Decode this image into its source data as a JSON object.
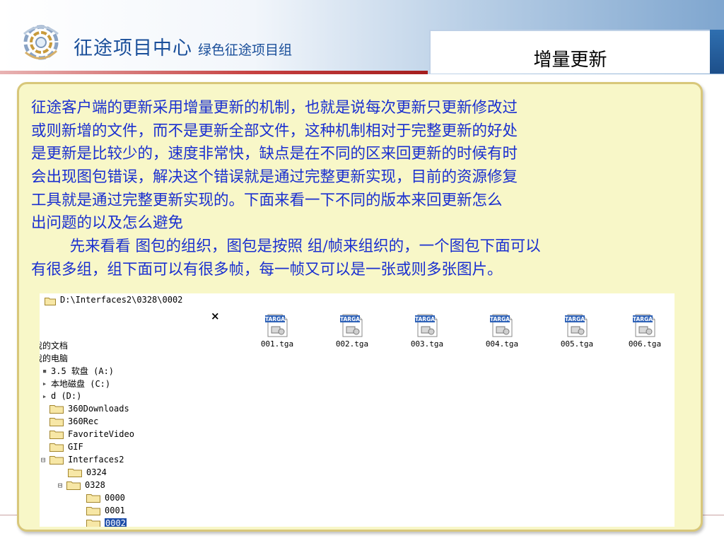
{
  "header": {
    "brand_main": "征途项目中心",
    "brand_sub": "绿色征途项目组",
    "tab_title": "增量更新"
  },
  "body": {
    "lines": [
      " 征途客户端的更新采用增量更新的机制，也就是说每次更新只更新修改过",
      "或则新增的文件，而不是更新全部文件，这种机制相对于完整更新的好处",
      "是更新是比较少的，速度非常快，缺点是在不同的区来回更新的时候有时",
      "会出现图包错误，解决这个错误就是通过完整更新实现，目前的资源修复",
      "工具就是通过完整更新实现的。下面来看一下不同的版本来回更新怎么",
      "出问题的以及怎么避免",
      "        先来看看 图包的组织，图包是按照 组/帧来组织的，一个图包下面可以",
      "有很多组，组下面可以有很多帧，每一帧又可以是一张或则多张图片。"
    ]
  },
  "explorer": {
    "address": "D:\\Interfaces2\\0328\\0002",
    "close_glyph": "×",
    "tree": [
      {
        "label": "我的文档",
        "glyph": ""
      },
      {
        "label": "我的电脑",
        "glyph": ""
      },
      {
        "label": "3.5 软盘 (A:)",
        "glyph": "▪"
      },
      {
        "label": "本地磁盘 (C:)",
        "glyph": "▸"
      },
      {
        "label": "d (D:)",
        "glyph": "▸"
      },
      {
        "label": "360Downloads",
        "glyph": ""
      },
      {
        "label": "360Rec",
        "glyph": ""
      },
      {
        "label": "FavoriteVideo",
        "glyph": ""
      },
      {
        "label": "GIF",
        "glyph": ""
      },
      {
        "label": "Interfaces2",
        "glyph": "⊟"
      },
      {
        "label": "0324",
        "glyph": ""
      },
      {
        "label": "0328",
        "glyph": "⊟"
      },
      {
        "label": "0000",
        "glyph": ""
      },
      {
        "label": "0001",
        "glyph": ""
      },
      {
        "label": "0002",
        "glyph": ""
      }
    ],
    "icon_badge": "TARGA",
    "files": [
      "001.tga",
      "002.tga",
      "003.tga",
      "004.tga",
      "005.tga",
      "006.tga"
    ]
  },
  "colors": {
    "body_text": "#1a2fd0",
    "panel_bg": "#f8f7c8",
    "brand": "#1a4f9a",
    "selection": "#1c4ca8"
  }
}
